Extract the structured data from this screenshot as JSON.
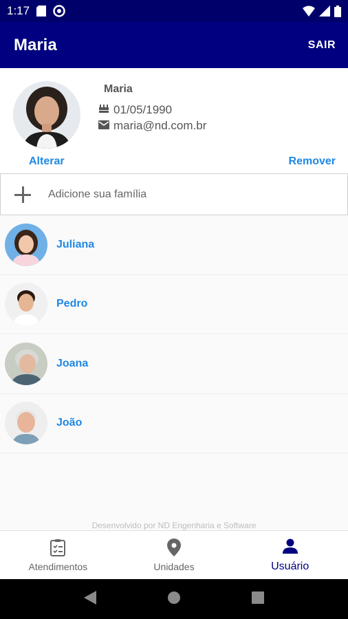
{
  "status_bar": {
    "time": "1:17"
  },
  "app_bar": {
    "title": "Maria",
    "action": "SAIR"
  },
  "profile": {
    "name": "Maria",
    "birthdate": "01/05/1990",
    "email": "maria@nd.com.br",
    "alter_label": "Alterar",
    "remove_label": "Remover"
  },
  "add_family": {
    "label": "Adicione sua família"
  },
  "family": [
    {
      "name": "Juliana"
    },
    {
      "name": "Pedro"
    },
    {
      "name": "Joana"
    },
    {
      "name": "João"
    }
  ],
  "footer": {
    "credit": "Desenvolvido por ND Engenharia e Software"
  },
  "bottom_nav": [
    {
      "label": "Atendimentos",
      "icon": "clipboard-icon"
    },
    {
      "label": "Unidades",
      "icon": "location-pin-icon"
    },
    {
      "label": "Usuário",
      "icon": "person-icon",
      "active": true
    }
  ],
  "colors": {
    "primary": "#000080",
    "link": "#1e88e5"
  }
}
